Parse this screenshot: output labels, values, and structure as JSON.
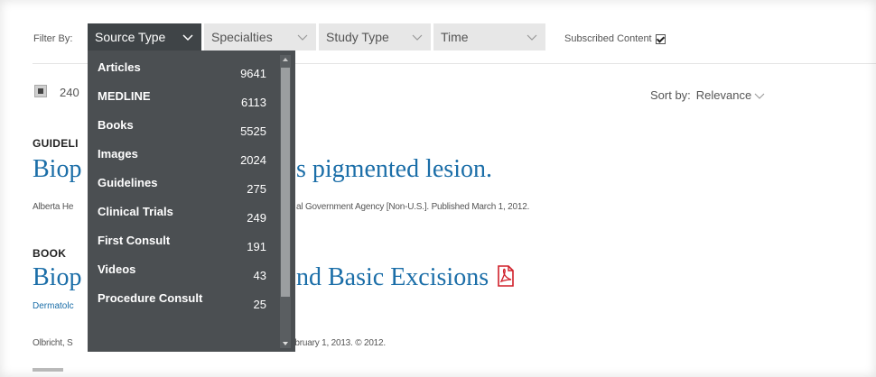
{
  "filters": {
    "label": "Filter By:",
    "tabs": [
      {
        "label": "Source Type"
      },
      {
        "label": "Specialties"
      },
      {
        "label": "Study Type"
      },
      {
        "label": "Time"
      }
    ],
    "subscribed_label": "Subscribed Content",
    "subscribed_checked": true
  },
  "results_header": {
    "count": "240",
    "sort_label": "Sort by:",
    "sort_value": "Relevance"
  },
  "results": [
    {
      "type": "GUIDELI",
      "title_start": "Biop",
      "title_end": "s pigmented lesion.",
      "meta_start": "Alberta He",
      "meta_end": "al Government Agency [Non-U.S.]. Published March 1, 2012."
    },
    {
      "type": "BOOK",
      "title_start": "Biop",
      "title_end": "nd Basic Excisions",
      "link_start": "Dermatolc",
      "meta_start": "Olbricht, S",
      "meta_end": "ebruary 1, 2013. © 2012."
    }
  ],
  "source_type_menu": {
    "items": [
      {
        "label": "Articles",
        "count": "9641"
      },
      {
        "label": "MEDLINE",
        "count": "6113"
      },
      {
        "label": "Books",
        "count": "5525"
      },
      {
        "label": "Images",
        "count": "2024"
      },
      {
        "label": "Guidelines",
        "count": "275"
      },
      {
        "label": "Clinical Trials",
        "count": "249"
      },
      {
        "label": "First Consult",
        "count": "191"
      },
      {
        "label": "Videos",
        "count": "43"
      },
      {
        "label": "Procedure Consult",
        "count": "25"
      }
    ]
  },
  "colors": {
    "link": "#1b6ea8",
    "active_tab": "#3f4447",
    "dropdown_bg": "#4b4f52",
    "pdf_red": "#d0202a"
  },
  "icons": {
    "chevron": "chevron-down-icon",
    "pdf": "pdf-icon",
    "checkbox": "checkbox-icon"
  }
}
